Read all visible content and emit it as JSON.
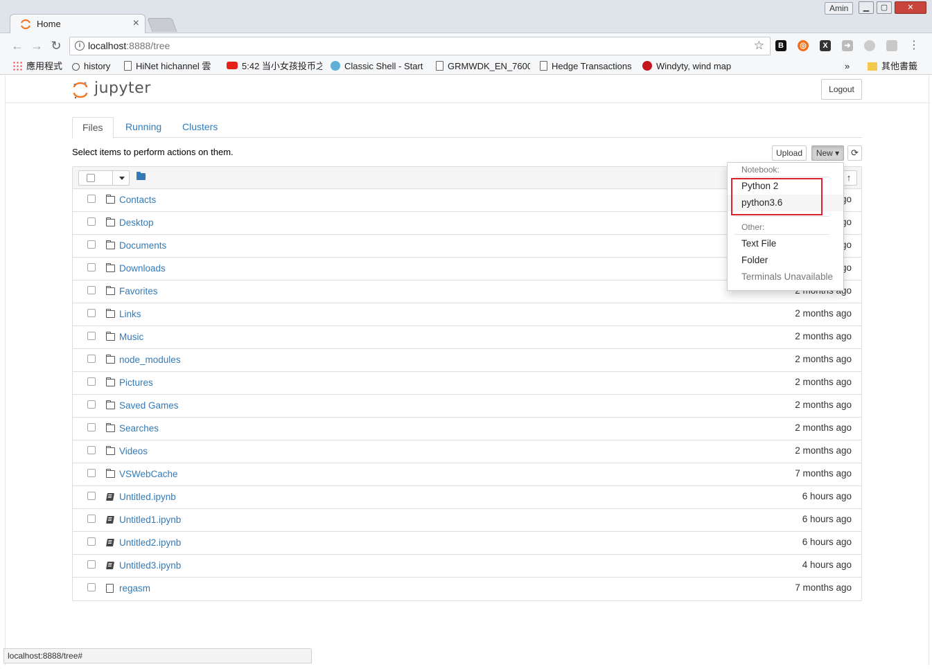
{
  "browser": {
    "tab_title": "Home",
    "tab_close": "×",
    "user_name": "Amin",
    "window_buttons": {
      "minimize": "▁",
      "maximize": "▢",
      "close": "✕"
    },
    "url_host": "localhost",
    "url_path": ":8888/tree",
    "status_url": "localhost:8888/tree#",
    "bookmarks": [
      {
        "label": "應用程式",
        "icon": "apps-icon"
      },
      {
        "label": "history",
        "icon": "history-icon"
      },
      {
        "label": "HiNet hichannel 雲",
        "icon": "page-icon"
      },
      {
        "label": "5:42 当小女孩投币之",
        "icon": "youtube-icon"
      },
      {
        "label": "Classic Shell - Start",
        "icon": "classic-shell-icon"
      },
      {
        "label": "GRMWDK_EN_7600",
        "icon": "page-icon"
      },
      {
        "label": "Hedge Transactions",
        "icon": "page-icon"
      },
      {
        "label": "Windyty, wind map",
        "icon": "windyty-icon"
      }
    ],
    "bookmarks_overflow": "»",
    "other_bookmarks": "其他書籤",
    "colors": {
      "chrome_bg": "#dfe3ea",
      "toolbar_bg": "#f6f7f9"
    }
  },
  "jupyter": {
    "logo_text": "jupyter",
    "logout_label": "Logout",
    "tabs": [
      {
        "label": "Files",
        "active": true
      },
      {
        "label": "Running",
        "active": false
      },
      {
        "label": "Clusters",
        "active": false
      }
    ],
    "hint": "Select items to perform actions on them.",
    "upload_label": "Upload",
    "new_label": "New ▾",
    "refresh_glyph": "⟳",
    "sort_glyph": "↑",
    "colors": {
      "link": "#337ab7",
      "highlight": "#e0202e"
    }
  },
  "files": [
    {
      "name": "Contacts",
      "type": "folder",
      "modified": "2 months ago"
    },
    {
      "name": "Desktop",
      "type": "folder",
      "modified": "2 months ago"
    },
    {
      "name": "Documents",
      "type": "folder",
      "modified": "2 months ago"
    },
    {
      "name": "Downloads",
      "type": "folder",
      "modified": "2 months ago"
    },
    {
      "name": "Favorites",
      "type": "folder",
      "modified": "2 months ago"
    },
    {
      "name": "Links",
      "type": "folder",
      "modified": "2 months ago"
    },
    {
      "name": "Music",
      "type": "folder",
      "modified": "2 months ago"
    },
    {
      "name": "node_modules",
      "type": "folder",
      "modified": "2 months ago"
    },
    {
      "name": "Pictures",
      "type": "folder",
      "modified": "2 months ago"
    },
    {
      "name": "Saved Games",
      "type": "folder",
      "modified": "2 months ago"
    },
    {
      "name": "Searches",
      "type": "folder",
      "modified": "2 months ago"
    },
    {
      "name": "Videos",
      "type": "folder",
      "modified": "2 months ago"
    },
    {
      "name": "VSWebCache",
      "type": "folder",
      "modified": "7 months ago"
    },
    {
      "name": "Untitled.ipynb",
      "type": "notebook",
      "modified": "6 hours ago"
    },
    {
      "name": "Untitled1.ipynb",
      "type": "notebook",
      "modified": "6 hours ago"
    },
    {
      "name": "Untitled2.ipynb",
      "type": "notebook",
      "modified": "6 hours ago"
    },
    {
      "name": "Untitled3.ipynb",
      "type": "notebook",
      "modified": "4 hours ago"
    },
    {
      "name": "regasm",
      "type": "file",
      "modified": "7 months ago"
    }
  ],
  "new_menu": {
    "notebook_header": "Notebook:",
    "notebooks": [
      "Python 2",
      "python3.6"
    ],
    "other_header": "Other:",
    "other_items": [
      "Text File",
      "Folder"
    ],
    "terminals": "Terminals Unavailable"
  }
}
